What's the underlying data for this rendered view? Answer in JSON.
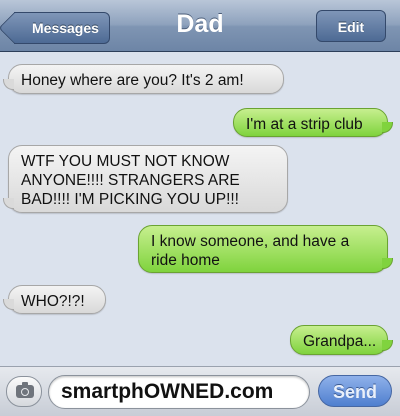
{
  "navbar": {
    "title": "Dad",
    "back_label": "Messages",
    "edit_label": "Edit"
  },
  "messages": [
    {
      "from": "them",
      "text": "Honey where are you? It's 2 am!"
    },
    {
      "from": "me",
      "text": "I'm at a strip club"
    },
    {
      "from": "them",
      "text": "WTF YOU MUST NOT KNOW ANYONE!!!! STRANGERS ARE BAD!!!! I'M PICKING YOU UP!!!"
    },
    {
      "from": "me",
      "text": "I know someone, and have a ride home"
    },
    {
      "from": "them",
      "text": "WHO?!?!"
    },
    {
      "from": "me",
      "text": "Grandpa..."
    }
  ],
  "composer": {
    "camera_icon": "camera-icon",
    "input_value": "smartphOWNED.com",
    "send_label": "Send"
  },
  "colors": {
    "incoming_bubble": "#e6e6e6",
    "outgoing_bubble": "#8fd84a",
    "background": "#dbe2ed",
    "navbar": "#8ea2bd",
    "send_button": "#6b95dc"
  }
}
